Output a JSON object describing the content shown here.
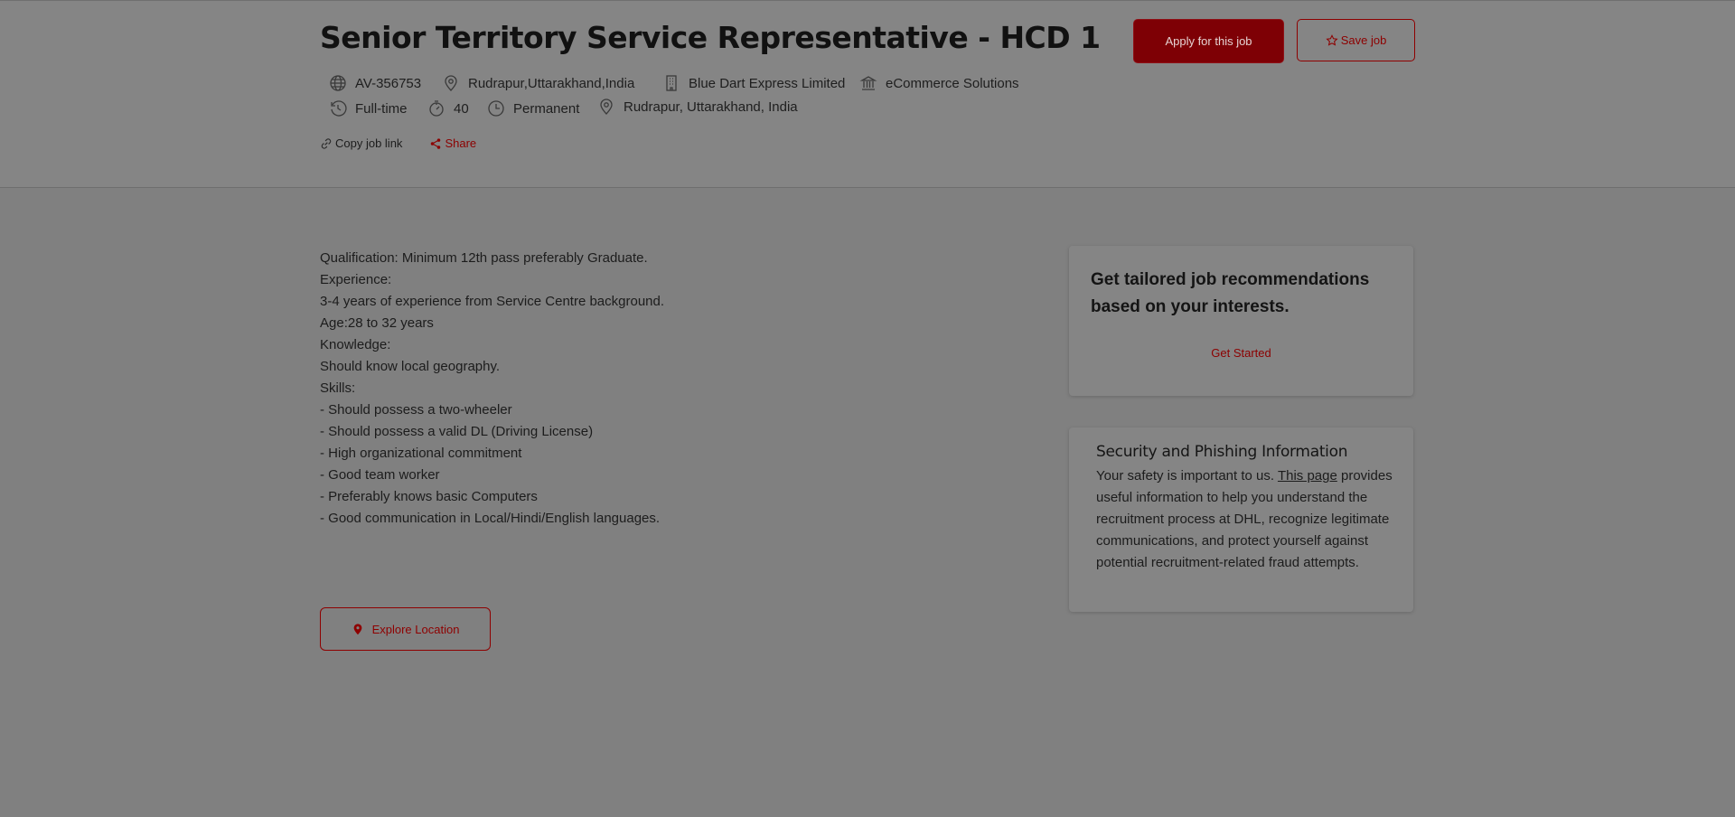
{
  "job": {
    "title": "Senior Territory Service Representative - HCD 1",
    "id": "AV-356753",
    "city": "Rudrapur,Uttarakhand,India",
    "company": "Blue Dart Express Limited",
    "division": "eCommerce Solutions",
    "job_type": "Full-time",
    "hours": "40",
    "contract": "Permanent",
    "location": "Rudrapur, Uttarakhand, India"
  },
  "actions": {
    "apply_label": "Apply for this job",
    "save_label": "Save job",
    "copy_link_label": "Copy job link",
    "share_label": "Share",
    "explore_label": "Explore Location"
  },
  "description": [
    "Qualification: Minimum 12th pass preferably Graduate.",
    "Experience:",
    "3-4 years of experience from Service Centre background.",
    "Age:28 to 32 years",
    "Knowledge:",
    "Should know local geography.",
    "Skills:",
    "- Should possess a two-wheeler",
    "- Should possess a valid DL (Driving License)",
    "- High organizational commitment",
    "- Good team worker",
    "- Preferably knows basic Computers",
    "- Good communication in Local/Hindi/English languages."
  ],
  "recommendations": {
    "title": "Get tailored job recommendations based on your interests.",
    "cta": "Get Started"
  },
  "security": {
    "title": "Security and Phishing Information",
    "intro": "Your safety is important to us.",
    "link_text": "This page",
    "body": "provides useful information to help you understand the recruitment process at DHL, recognize legitimate communications, and protect yourself against potential recruitment-related fraud attempts."
  },
  "colors": {
    "accent": "#8e0000",
    "overlay_bg": "#808080"
  }
}
